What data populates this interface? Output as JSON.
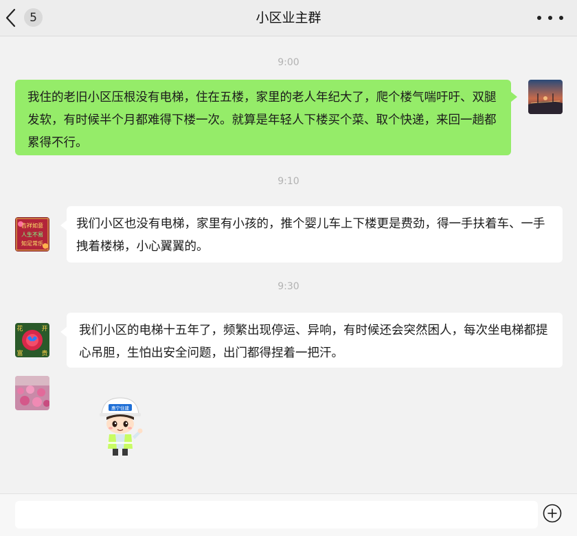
{
  "header": {
    "back_icon": "chevron-left-icon",
    "unread_count": "5",
    "title": "小区业主群",
    "more_icon": "more-dots-icon"
  },
  "messages": [
    {
      "time": "9:00",
      "side": "right",
      "avatar": "sunset-bridge-avatar",
      "text": "我住的老旧小区压根没有电梯，住在五楼，家里的老人年纪大了，爬个楼气喘吁吁、双腿发软，有时候半个月都难得下楼一次。就算是年轻人下楼买个菜、取个快递，来回一趟都累得不行。"
    },
    {
      "time": "9:10",
      "side": "left",
      "avatar": "red-text-greeting-avatar",
      "avatar_lines": [
        "吉祥如意",
        "人生不易",
        "知足常乐"
      ],
      "text": "我们小区也没有电梯，家里有小孩的，推个婴儿车上下楼更是费劲，得一手扶着车、一手拽着楼梯，小心翼翼的。"
    },
    {
      "time": "9:30",
      "side": "left",
      "avatar": "flower-butterfly-avatar",
      "avatar_chars": [
        "花",
        "开",
        "富",
        "贵"
      ],
      "text": "我们小区的电梯十五年了，频繁出现停运、异响，有时候还会突然困人，每次坐电梯都提心吊胆，生怕出安全问题，出门都得捏着一把汗。"
    },
    {
      "side": "left",
      "avatar": "pink-flower-field-avatar",
      "type": "sticker",
      "sticker": "worker-helmet-sticker",
      "sticker_text": "惠宁住建"
    }
  ],
  "input": {
    "value": "",
    "plus_icon": "plus-circle-icon"
  },
  "colors": {
    "my_bubble": "#95ec69",
    "their_bubble": "#ffffff",
    "background": "#f2f2f2"
  }
}
